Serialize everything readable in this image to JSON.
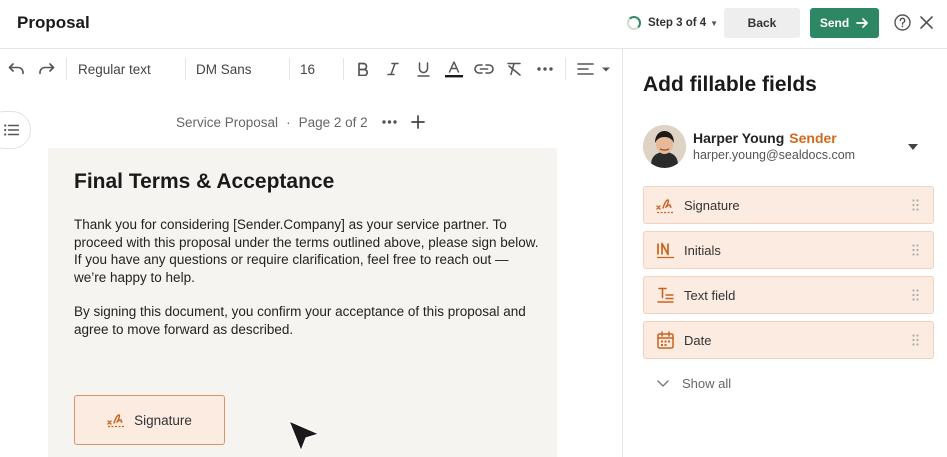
{
  "header": {
    "title": "Proposal",
    "step": "Step 3 of 4",
    "back_label": "Back",
    "send_label": "Send"
  },
  "toolbar": {
    "text_style": "Regular text",
    "font_family": "DM Sans",
    "font_size": "16"
  },
  "document": {
    "name": "Service Proposal",
    "page_info": "Page 2 of 2",
    "heading": "Final Terms & Acceptance",
    "paragraph_1": "Thank you for considering [Sender.Company] as your service partner. To proceed with this proposal under the terms outlined above, please sign below. If you have any questions or require clarification, feel free to reach out — we’re happy to help.",
    "paragraph_2": "By signing this document, you confirm your acceptance of this proposal and agree to move forward as described.",
    "signature_field_label": "Signature"
  },
  "panel": {
    "title": "Add fillable fields",
    "user": {
      "name": "Harper Young",
      "role": "Sender",
      "email": "harper.young@sealdocs.com"
    },
    "fields": [
      {
        "label": "Signature",
        "icon": "signature-icon"
      },
      {
        "label": "Initials",
        "icon": "initials-icon"
      },
      {
        "label": "Text field",
        "icon": "text-field-icon"
      },
      {
        "label": "Date",
        "icon": "calendar-icon"
      }
    ],
    "show_all": "Show all"
  },
  "colors": {
    "accent_green": "#2d8764",
    "field_bg": "#fbebe1",
    "field_icon": "#c8641e",
    "sender_role": "#d2691e"
  }
}
